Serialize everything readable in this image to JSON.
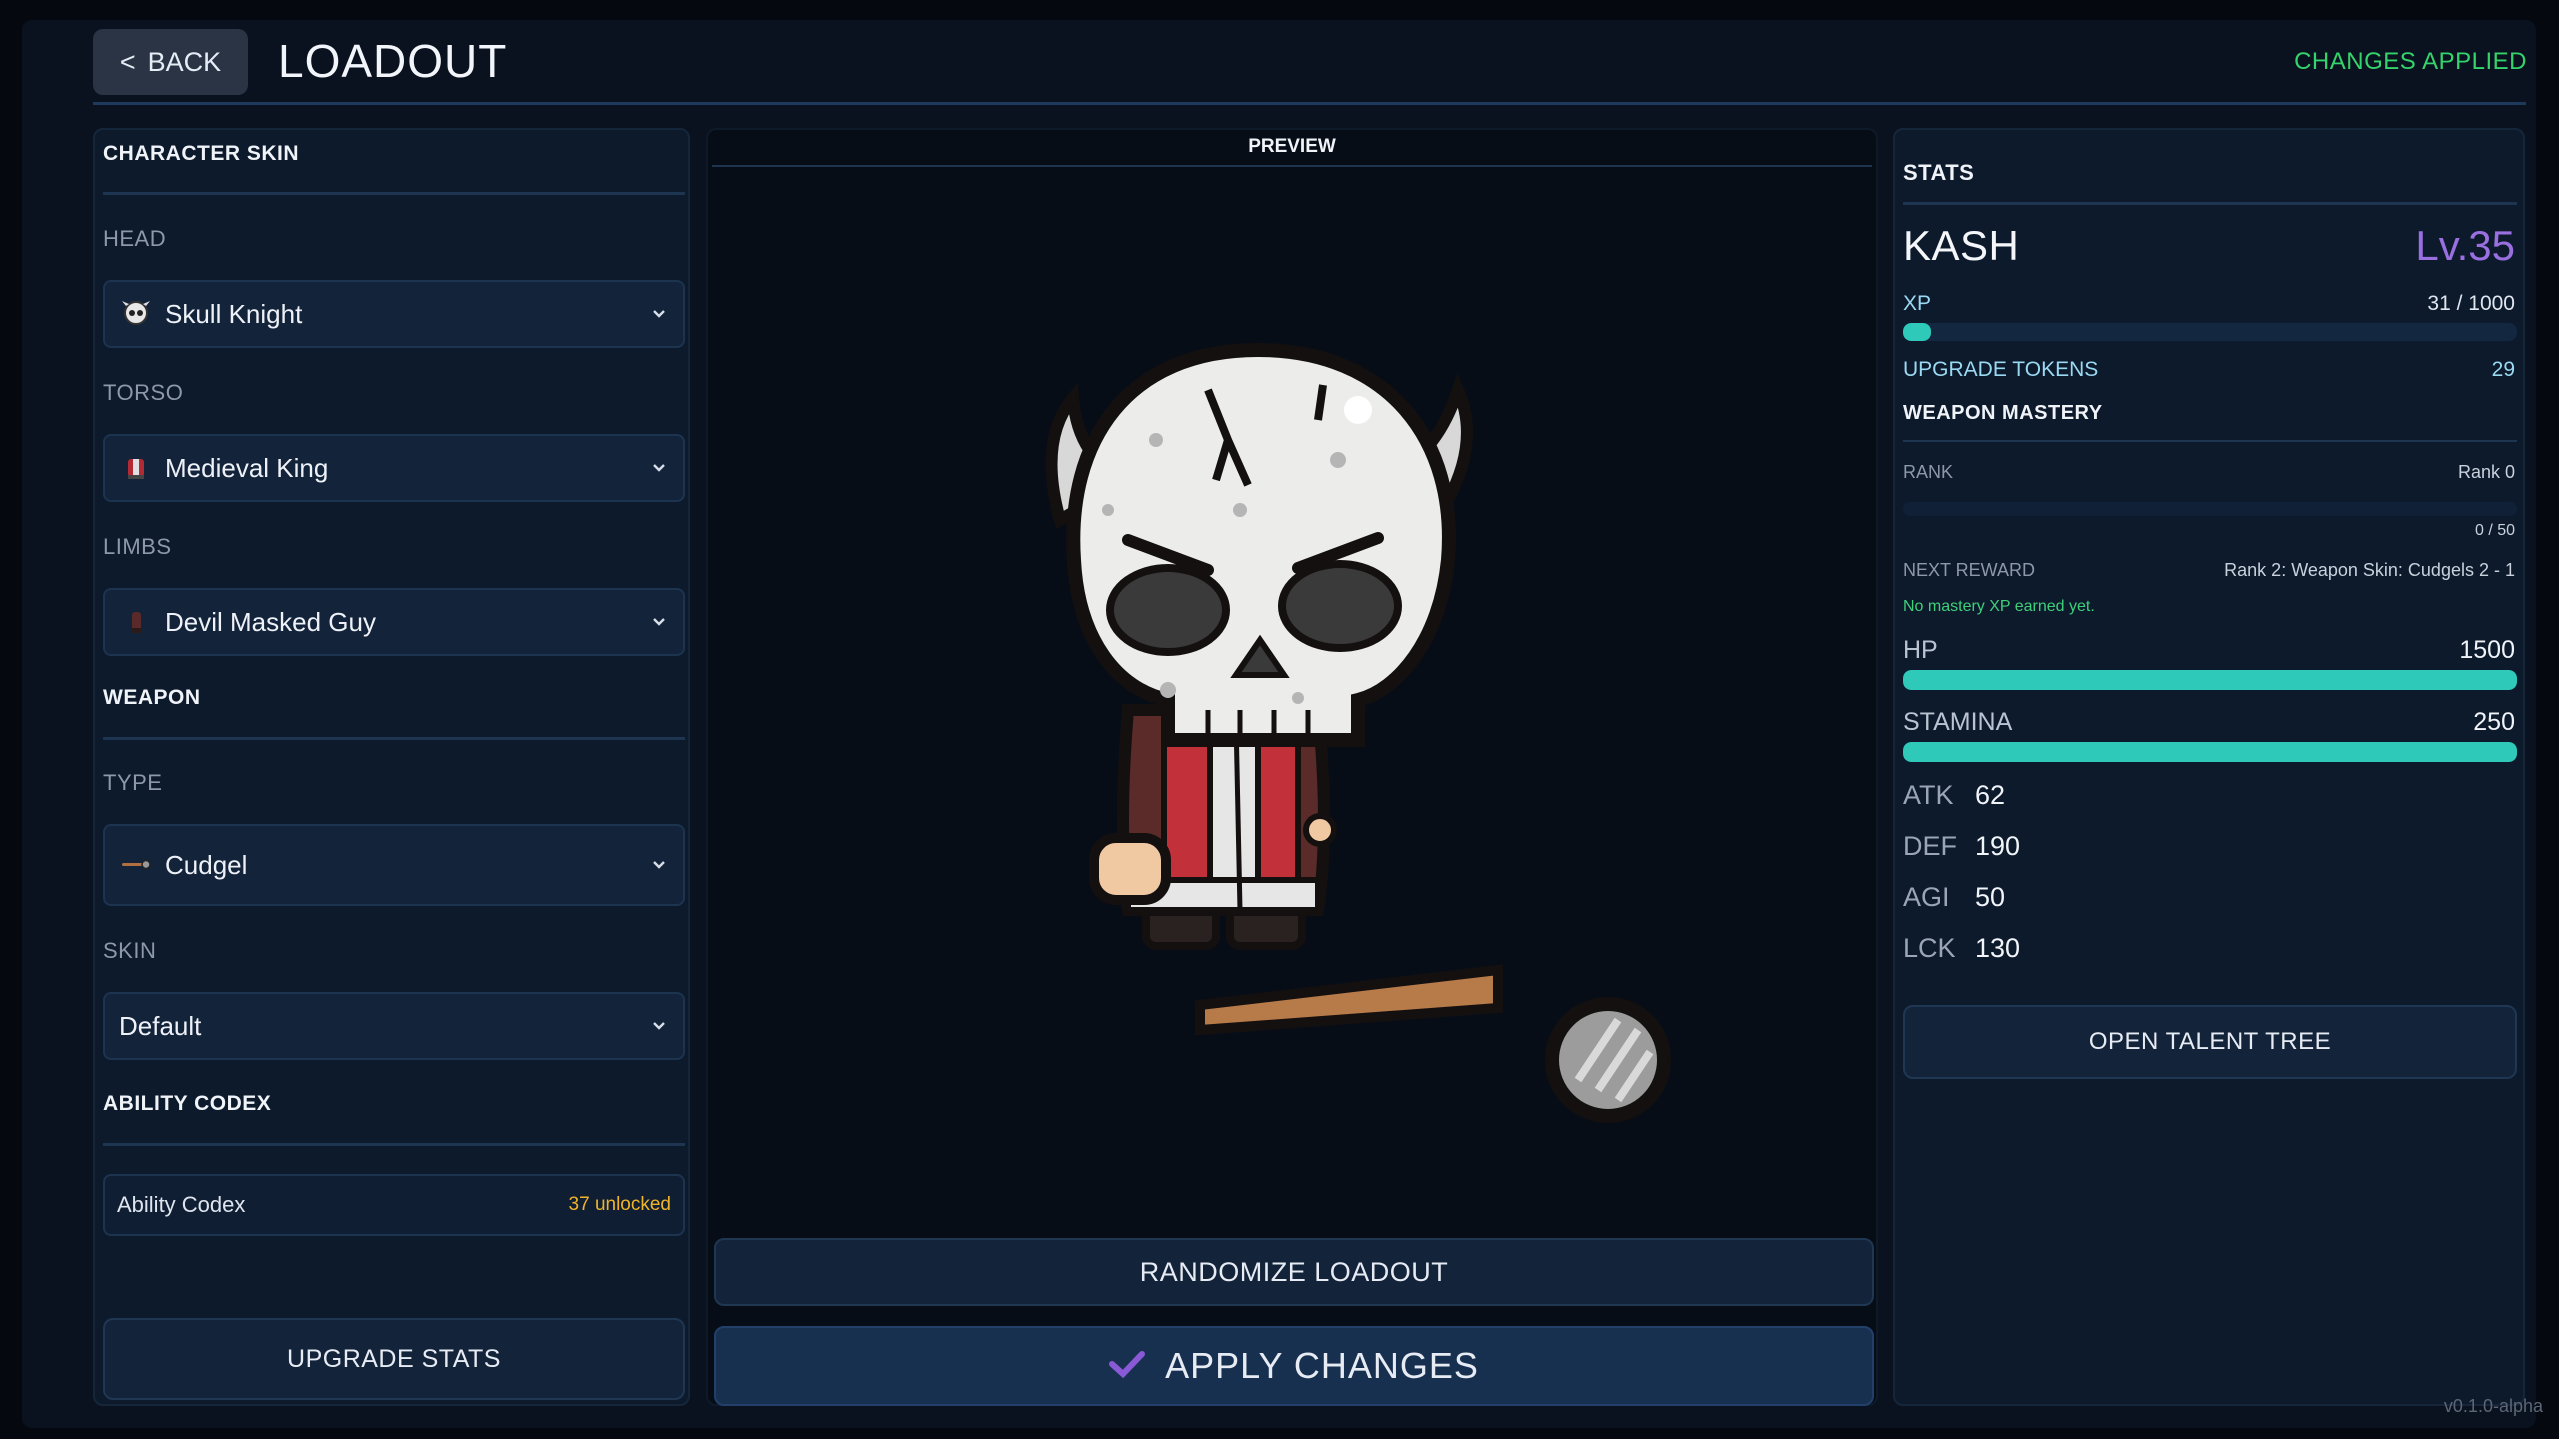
{
  "header": {
    "back_label": "BACK",
    "title": "LOADOUT",
    "status": "CHANGES APPLIED"
  },
  "left": {
    "character_skin_title": "CHARACTER SKIN",
    "head_label": "HEAD",
    "head_value": "Skull Knight",
    "torso_label": "TORSO",
    "torso_value": "Medieval King",
    "limbs_label": "LIMBS",
    "limbs_value": "Devil Masked Guy",
    "weapon_title": "WEAPON",
    "type_label": "TYPE",
    "type_value": "Cudgel",
    "skin_label": "SKIN",
    "skin_value": "Default",
    "codex_title": "ABILITY CODEX",
    "codex_label": "Ability Codex",
    "codex_count": "37 unlocked",
    "upgrade_label": "UPGRADE STATS"
  },
  "center": {
    "preview_title": "PREVIEW",
    "randomize_label": "RANDOMIZE LOADOUT",
    "apply_label": "APPLY CHANGES"
  },
  "right": {
    "stats_title": "STATS",
    "name": "KASH",
    "level": "Lv.35",
    "xp_label": "XP",
    "xp_value": "31 / 1000",
    "xp_fraction": 0.031,
    "tokens_label": "UPGRADE TOKENS",
    "tokens_value": "29",
    "mastery_title": "WEAPON MASTERY",
    "rank_label": "RANK",
    "rank_value": "Rank 0",
    "rank_progress": "0 / 50",
    "rank_fraction": 0,
    "next_reward_label": "NEXT REWARD",
    "next_reward_value": "Rank 2: Weapon Skin: Cudgels 2 - 1",
    "mastery_note": "No mastery XP earned yet.",
    "hp_label": "HP",
    "hp_value": "1500",
    "hp_fraction": 1.0,
    "stamina_label": "STAMINA",
    "stamina_value": "250",
    "stamina_fraction": 1.0,
    "attributes": [
      {
        "key": "ATK",
        "value": "62"
      },
      {
        "key": "DEF",
        "value": "190"
      },
      {
        "key": "AGI",
        "value": "50"
      },
      {
        "key": "LCK",
        "value": "130"
      }
    ],
    "talent_label": "OPEN TALENT TREE"
  },
  "version": "v0.1.0-alpha",
  "colors": {
    "accent_green": "#35d36b",
    "level_purple": "#9a6fe0",
    "bar_teal": "#2ec9b9",
    "codex_gold": "#f0b429"
  }
}
